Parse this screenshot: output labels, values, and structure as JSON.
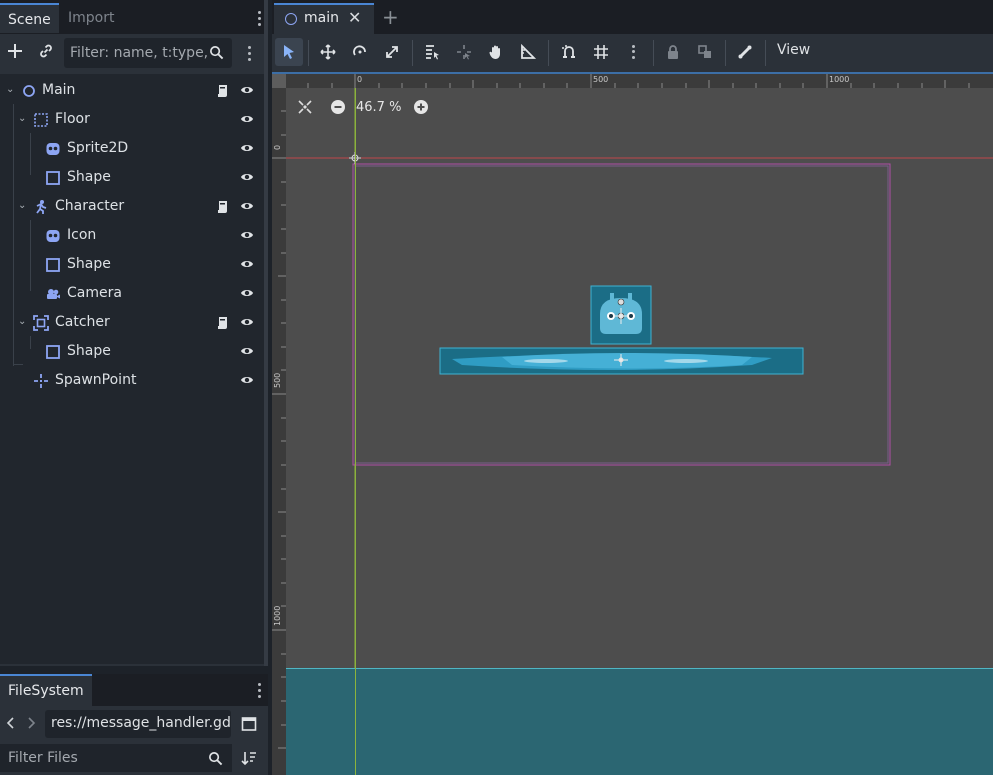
{
  "left_dock": {
    "tabs": [
      {
        "label": "Scene"
      },
      {
        "label": "Import"
      }
    ],
    "filter_placeholder": "Filter: name, t:type,",
    "tree": [
      {
        "label": "Main",
        "icon": "node2d-circle-icon",
        "script": true
      },
      {
        "label": "Floor",
        "icon": "staticbody-icon",
        "script": false
      },
      {
        "label": "Sprite2D",
        "icon": "sprite2d-icon",
        "script": false
      },
      {
        "label": "Shape",
        "icon": "collision-shape-icon",
        "script": false
      },
      {
        "label": "Character",
        "icon": "characterbody-icon",
        "script": true
      },
      {
        "label": "Icon",
        "icon": "sprite2d-icon",
        "script": false
      },
      {
        "label": "Shape",
        "icon": "collision-shape-icon",
        "script": false
      },
      {
        "label": "Camera",
        "icon": "camera2d-icon",
        "script": false
      },
      {
        "label": "Catcher",
        "icon": "area2d-icon",
        "script": true
      },
      {
        "label": "Shape",
        "icon": "collision-shape-icon",
        "script": false
      },
      {
        "label": "SpawnPoint",
        "icon": "marker2d-icon",
        "script": false
      }
    ]
  },
  "filesystem": {
    "tab_label": "FileSystem",
    "path": "res://message_handler.gd",
    "filter_placeholder": "Filter Files"
  },
  "editor": {
    "tab_label": "main",
    "view_label": "View",
    "zoom": "46.7 %",
    "ruler_h": [
      "0",
      "500",
      "1000"
    ],
    "ruler_v": [
      "0",
      "500",
      "1000"
    ]
  },
  "colors": {
    "accent": "#4a86d4",
    "node_icon": "#8da5f3",
    "viewport_bg": "#4d4d4d",
    "teal": "#2b6672"
  }
}
